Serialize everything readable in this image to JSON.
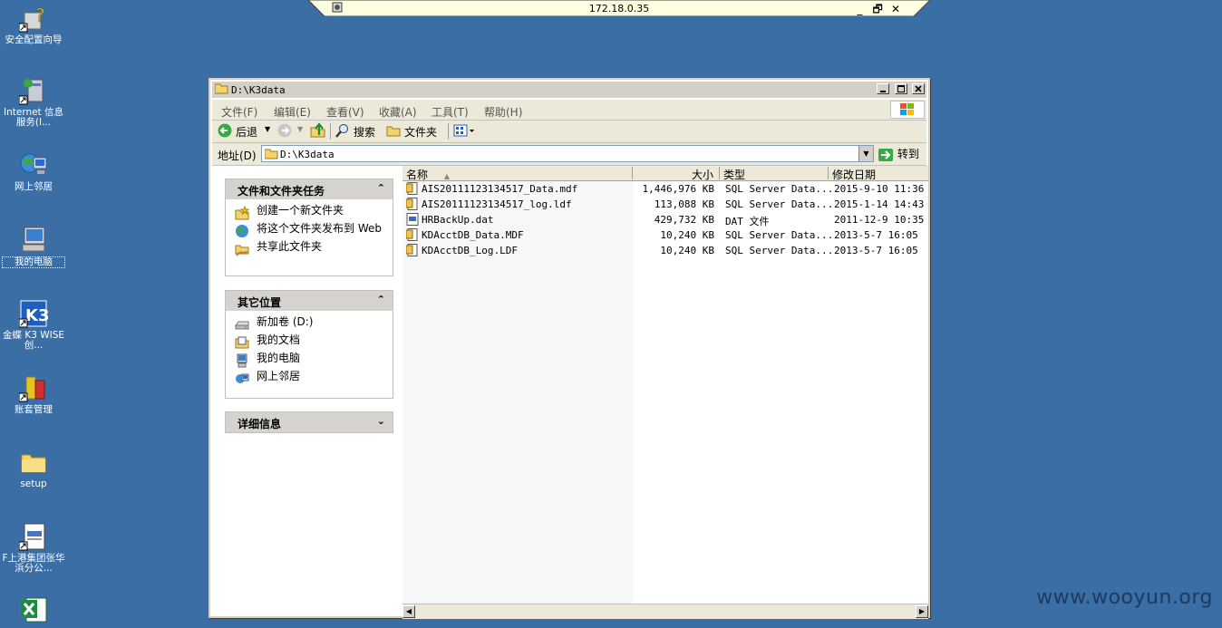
{
  "rdp": {
    "host": "172.18.0.35",
    "minimize": "_",
    "restore": "🗗",
    "close": "✕"
  },
  "desktop": [
    {
      "label": "安全配置向导",
      "icon": "security-wizard-icon"
    },
    {
      "label": "Internet 信息服务(I...",
      "icon": "iis-icon"
    },
    {
      "label": "网上邻居",
      "icon": "network-places-icon"
    },
    {
      "label": "我的电脑",
      "icon": "my-computer-icon"
    },
    {
      "label": "金蝶 K3 WISE创...",
      "icon": "k3-icon"
    },
    {
      "label": "账套管理",
      "icon": "account-manager-icon"
    },
    {
      "label": "setup",
      "icon": "folder-icon"
    },
    {
      "label": "F上港集团张华浜分公...",
      "icon": "document-icon"
    },
    {
      "label": "",
      "icon": "excel-icon"
    }
  ],
  "window": {
    "title": "D:\\K3data",
    "menu": [
      "文件(F)",
      "编辑(E)",
      "查看(V)",
      "收藏(A)",
      "工具(T)",
      "帮助(H)"
    ],
    "toolbar": {
      "back": "后退",
      "search": "搜索",
      "folders": "文件夹"
    },
    "address": {
      "label": "地址(D)",
      "value": "D:\\K3data",
      "go": "转到"
    },
    "tasks": {
      "title": "文件和文件夹任务",
      "items": [
        "创建一个新文件夹",
        "将这个文件夹发布到 Web",
        "共享此文件夹"
      ]
    },
    "places": {
      "title": "其它位置",
      "items": [
        "新加卷 (D:)",
        "我的文档",
        "我的电脑",
        "网上邻居"
      ]
    },
    "details": {
      "title": "详细信息"
    },
    "columns": {
      "name": "名称",
      "size": "大小",
      "type": "类型",
      "modified": "修改日期"
    },
    "files": [
      {
        "name": "AIS20111123134517_Data.mdf",
        "size": "1,446,976 KB",
        "type": "SQL Server Data...",
        "modified": "2015-9-10 11:36"
      },
      {
        "name": "AIS20111123134517_log.ldf",
        "size": "113,088 KB",
        "type": "SQL Server Data...",
        "modified": "2015-1-14 14:43"
      },
      {
        "name": "HRBackUp.dat",
        "size": "429,732 KB",
        "type": "DAT 文件",
        "modified": "2011-12-9 10:35"
      },
      {
        "name": "KDAcctDB_Data.MDF",
        "size": "10,240 KB",
        "type": "SQL Server Data...",
        "modified": "2013-5-7 16:05"
      },
      {
        "name": "KDAcctDB_Log.LDF",
        "size": "10,240 KB",
        "type": "SQL Server Data...",
        "modified": "2013-5-7 16:05"
      }
    ]
  },
  "watermark": "www.wooyun.org"
}
